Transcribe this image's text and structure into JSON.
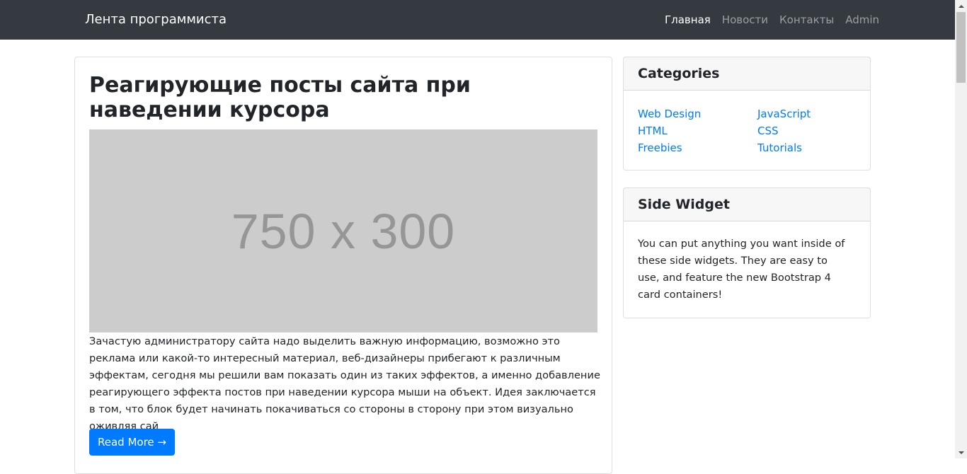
{
  "navbar": {
    "brand": "Лента программиста",
    "links": [
      {
        "label": "Главная",
        "active": true
      },
      {
        "label": "Новости",
        "active": false
      },
      {
        "label": "Контакты",
        "active": false
      },
      {
        "label": "Admin",
        "active": false
      }
    ]
  },
  "post": {
    "title": "Реагирующие посты сайта при наведении курсора",
    "image_placeholder": "750 x 300",
    "excerpt": "Зачастую администратору сайта надо выделить важную информацию, возможно это реклама или какой-то интересный материал, веб-дизайнеры прибегают к различным эффектам, сегодня мы решили вам показать один из таких эффектов, а именно добавление реагирующего эффекта постов при наведении курсора мыши на объект. Идея заключается в том, что блок будет начинать покачиваться со стороны в сторону при этом визуально оживляя сай",
    "read_more": "Read More →"
  },
  "categories": {
    "title": "Categories",
    "items": [
      "Web Design",
      "JavaScript",
      "HTML",
      "CSS",
      "Freebies",
      "Tutorials"
    ]
  },
  "side_widget": {
    "title": "Side Widget",
    "text": "You can put anything you want inside of these side widgets. They are easy to use, and feature the new Bootstrap 4 card containers!"
  },
  "colors": {
    "navbar_bg": "#343a40",
    "link": "#007bff",
    "button": "#007bff",
    "placeholder_bg": "#cccccc"
  }
}
